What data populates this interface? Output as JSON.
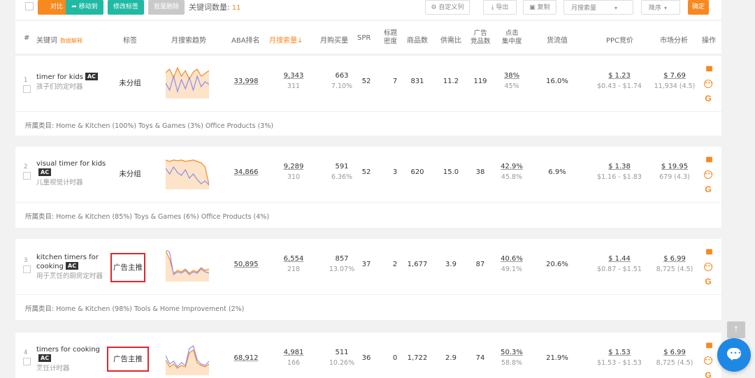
{
  "toolbar": {
    "compare": "对比",
    "move_to": "移动到",
    "edit_tag": "修改标签",
    "batch_delete": "批量删除",
    "kw_count_label": "关键词数量:",
    "kw_count": "11",
    "custom_cols": "自定义列",
    "export": "导出",
    "copy": "复制",
    "sort_field": "月搜索量",
    "sort_order": "降序",
    "confirm": "确定"
  },
  "header": {
    "num": "#",
    "keyword": "关键词",
    "data_help": "数据解释",
    "tag": "标签",
    "trend": "月搜索趋势",
    "aba": "ABA排名",
    "monthly_search": "月搜索量↓",
    "monthly_buy": "月购买量",
    "spr": "SPR",
    "title_density_1": "标题",
    "title_density_2": "密度",
    "products": "商品数",
    "supply_ratio": "供需比",
    "ad_products_1": "广告",
    "ad_products_2": "竞品数",
    "click_conc_1": "点击",
    "click_conc_2": "集中度",
    "conversion": "货流值",
    "ppc": "PPC竞价",
    "market": "市场分析",
    "ops": "操作"
  },
  "rows": [
    {
      "idx": "1",
      "keyword": "timer for kids",
      "ac": "AC",
      "keyword_cn": "孩子们的定时器",
      "tag": "未分组",
      "aba": "33,998",
      "search": "9,343",
      "search_sub": "311",
      "buy": "663",
      "buy_sub": "7.10%",
      "spr": "52",
      "title_density": "7",
      "products": "831",
      "supply": "11.2",
      "ad_products": "119",
      "click": "38%",
      "click_sub": "45%",
      "conv": "16.0%",
      "ppc": "$ 1.23",
      "ppc_range": "$0.43 - $1.74",
      "market": "$ 7.69",
      "market_sub": "11,934 (4.5)",
      "category": "所属类目: Home & Kitchen (100%) Toys & Games (3%) Office Products (3%)",
      "trend_orange": [
        35,
        40,
        28,
        42,
        30,
        38,
        26,
        36,
        40,
        30,
        34,
        38
      ],
      "trend_purple": [
        20,
        10,
        30,
        8,
        25,
        12,
        28,
        10,
        30,
        15,
        22,
        18
      ]
    },
    {
      "idx": "2",
      "keyword": "visual timer for kids",
      "ac": "AC",
      "keyword_cn": "儿童视觉计时器",
      "tag": "未分组",
      "aba": "34,866",
      "search": "9,289",
      "search_sub": "310",
      "buy": "591",
      "buy_sub": "6.36%",
      "spr": "52",
      "title_density": "3",
      "products": "620",
      "supply": "15.0",
      "ad_products": "38",
      "click": "42.9%",
      "click_sub": "45.8%",
      "conv": "6.9%",
      "ppc": "$ 1.38",
      "ppc_range": "$1.16 - $1.83",
      "market": "$ 19.95",
      "market_sub": "679 (4.3)",
      "category": "所属类目: Home & Kitchen (85%) Toys & Games (6%) Office Products (4%)",
      "trend_orange": [
        40,
        38,
        40,
        39,
        40,
        38,
        39,
        40,
        38,
        36,
        30,
        5
      ],
      "trend_purple": [
        28,
        20,
        30,
        22,
        18,
        26,
        14,
        20,
        12,
        6,
        10,
        4
      ]
    },
    {
      "idx": "3",
      "keyword": "kitchen timers for cooking",
      "ac": "AC",
      "keyword_cn": "用于烹饪的厨房定时器",
      "tag": "广告主推",
      "aba": "50,895",
      "search": "6,554",
      "search_sub": "218",
      "buy": "857",
      "buy_sub": "13.07%",
      "spr": "37",
      "title_density": "2",
      "products": "1,677",
      "supply": "3.9",
      "ad_products": "87",
      "click": "40.6%",
      "click_sub": "49.1%",
      "conv": "20.6%",
      "ppc": "$ 1.44",
      "ppc_range": "$0.87 - $1.51",
      "market": "$ 6.99",
      "market_sub": "8,725 (4.5)",
      "category": "所属类目: Home & Kitchen (98%) Tools & Home Improvement (2%)",
      "trend_orange": [
        42,
        30,
        10,
        14,
        12,
        16,
        10,
        14,
        12,
        18,
        14,
        16
      ],
      "trend_purple": [
        44,
        40,
        8,
        12,
        10,
        14,
        8,
        12,
        10,
        16,
        12,
        10
      ]
    },
    {
      "idx": "4",
      "keyword": "timers for cooking",
      "ac": "AC",
      "keyword_cn": "烹饪计时器",
      "tag": "广告主推",
      "aba": "68,912",
      "search": "4,981",
      "search_sub": "166",
      "buy": "511",
      "buy_sub": "10.26%",
      "spr": "36",
      "title_density": "0",
      "products": "1,722",
      "supply": "2.9",
      "ad_products": "74",
      "click": "50.3%",
      "click_sub": "58.8%",
      "conv": "21.9%",
      "ppc": "$ 1.53",
      "ppc_range": "$1.53 - $1.53",
      "market": "$ 6.99",
      "market_sub": "8,725 (4.5)",
      "category": "",
      "trend_orange": [
        20,
        10,
        14,
        8,
        12,
        10,
        30,
        34,
        16,
        12,
        10,
        14
      ],
      "trend_purple": [
        26,
        14,
        18,
        10,
        16,
        12,
        36,
        40,
        20,
        14,
        12,
        18
      ]
    }
  ],
  "colors": {
    "accent": "#f7891f",
    "teal": "#20b9a3",
    "purple": "#8a8ef0",
    "red_box": "#e0262b",
    "chat": "#1e88e5"
  }
}
